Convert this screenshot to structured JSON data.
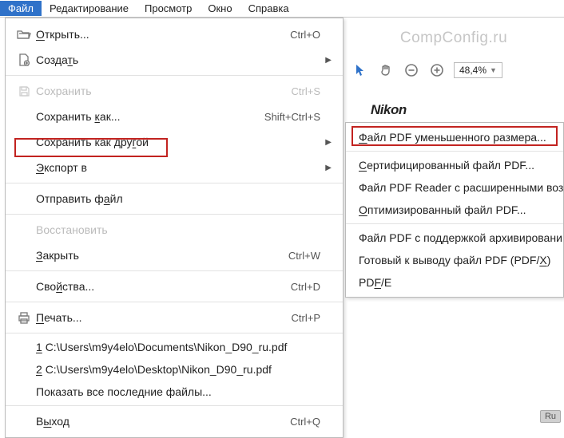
{
  "menubar": {
    "file": "Файл",
    "edit": "Редактирование",
    "view": "Просмотр",
    "window": "Окно",
    "help": "Справка"
  },
  "watermark": "CompConfig.ru",
  "toolbar": {
    "zoom_value": "48,4%"
  },
  "doc": {
    "brand": "Nikon"
  },
  "fileMenu": {
    "open": "Открыть...",
    "open_sc": "Ctrl+O",
    "create": "Создать",
    "save": "Сохранить",
    "save_sc": "Ctrl+S",
    "saveAs": "Сохранить как...",
    "saveAs_sc": "Shift+Ctrl+S",
    "saveOther": "Сохранить как другой",
    "export": "Экспорт в",
    "send": "Отправить файл",
    "restore": "Восстановить",
    "close": "Закрыть",
    "close_sc": "Ctrl+W",
    "props": "Свойства...",
    "props_sc": "Ctrl+D",
    "print": "Печать...",
    "print_sc": "Ctrl+P",
    "recent1_n": "1",
    "recent1": "C:\\Users\\m9y4elo\\Documents\\Nikon_D90_ru.pdf",
    "recent2_n": "2",
    "recent2": "C:\\Users\\m9y4elo\\Desktop\\Nikon_D90_ru.pdf",
    "recentAll": "Показать все последние файлы...",
    "exit": "Выход",
    "exit_sc": "Ctrl+Q"
  },
  "submenu": {
    "reduced": "айл PDF уменьшенного размера...",
    "certified": "ертифицированный файл PDF...",
    "reader": "Файл PDF Reader с расширенными воз",
    "optimized": "птимизированный файл PDF...",
    "archive": "Файл PDF с поддержкой архивировани",
    "printReady": "Готовый к выводу файл PDF (PDF/",
    "pdfe_pre": "PD",
    "pdfe_post": "/E"
  },
  "badge": "Ru"
}
